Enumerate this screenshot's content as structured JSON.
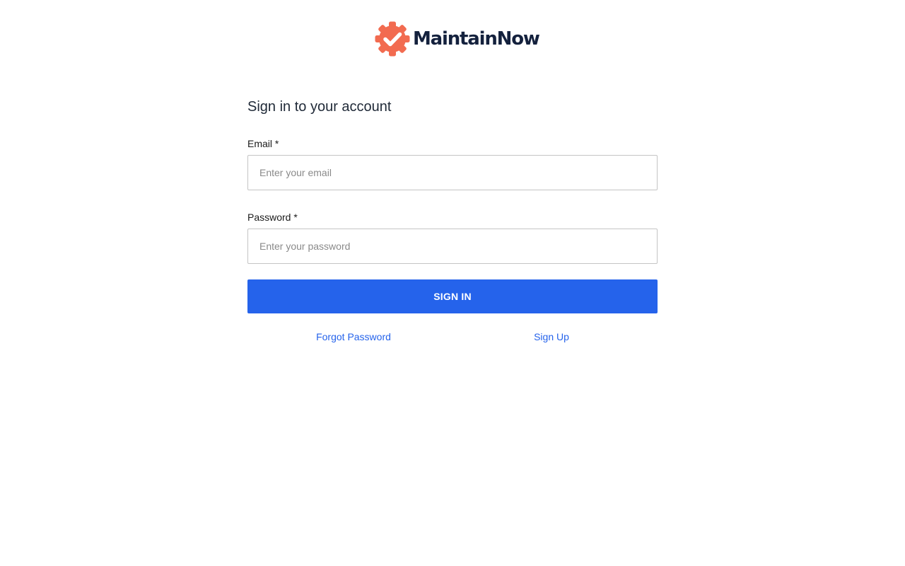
{
  "brand": {
    "name": "MaintainNow",
    "logo_icon": "gear-check-icon",
    "logo_color": "#f26b50",
    "text_color": "#14213d"
  },
  "form": {
    "heading": "Sign in to your account",
    "email": {
      "label": "Email *",
      "placeholder": "Enter your email",
      "value": ""
    },
    "password": {
      "label": "Password *",
      "placeholder": "Enter your password",
      "value": ""
    },
    "submit_label": "SIGN IN"
  },
  "links": {
    "forgot_password": "Forgot Password",
    "sign_up": "Sign Up"
  },
  "colors": {
    "accent": "#2563eb",
    "input_border": "#c4c4c4",
    "background": "#ffffff"
  }
}
